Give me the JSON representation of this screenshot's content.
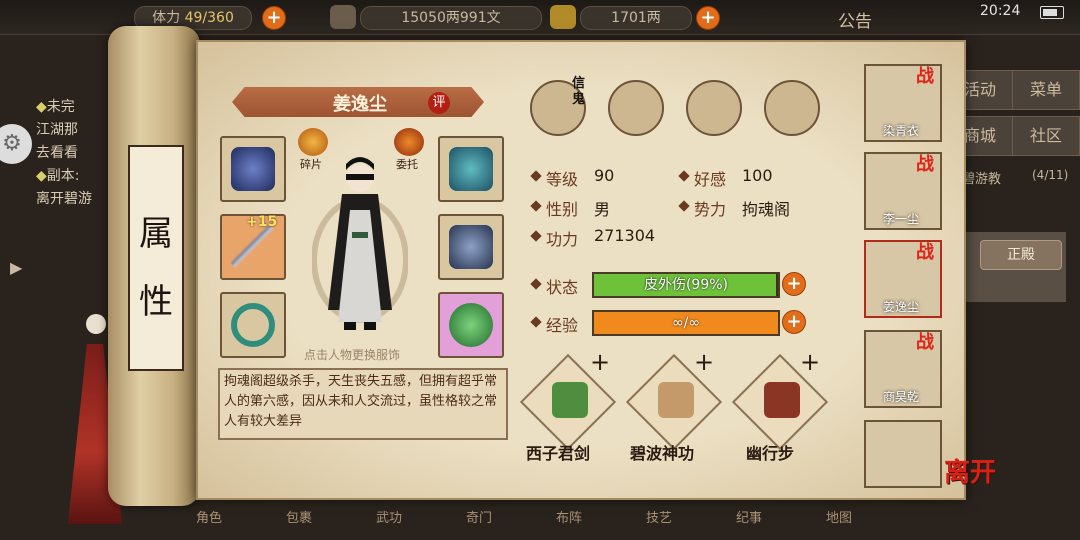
{
  "topbar": {
    "level_label": "体力",
    "stamina": "49/360",
    "silver": "15050两991文",
    "gold": "1701两",
    "notice": "公告",
    "time": "20:24"
  },
  "quest": {
    "line1": "未完",
    "line2": "江湖那",
    "line3": "去看看",
    "line4": "副本:",
    "line5": "离开碧游"
  },
  "bg_menu": {
    "activity": "活动",
    "menu": "菜单",
    "shop": "商城",
    "community": "社区",
    "biyou": "碧游教",
    "biyou_count": "(4/11)",
    "main": "正殿"
  },
  "scroll_title": "属性",
  "character": {
    "name": "姜逸尘",
    "rate": "评",
    "shard_label": "碎片",
    "delegate_label": "委托",
    "upgrade": "+15",
    "hint": "点击人物更换服饰",
    "bio": "拘魂阁超级杀手，天生丧失五感，但拥有超乎常人的第六感，因从未和人交流过，虽性格较之常人有较大差异"
  },
  "status_tag": "信鬼",
  "stats": {
    "level_label": "等级",
    "level_value": "90",
    "favor_label": "好感",
    "favor_value": "100",
    "gender_label": "性别",
    "gender_value": "男",
    "faction_label": "势力",
    "faction_value": "拘魂阁",
    "power_label": "功力",
    "power_value": "271304",
    "state_label": "状态",
    "state_text": "皮外伤(99%)",
    "state_progress": 0.99,
    "exp_label": "经验",
    "exp_text": "∞/∞",
    "exp_progress": 1.0
  },
  "skills": [
    {
      "name": "西子君剑"
    },
    {
      "name": "碧波神功"
    },
    {
      "name": "幽行步"
    }
  ],
  "skill_plus": "+",
  "roster": [
    {
      "name": "染青衣",
      "battle": "战"
    },
    {
      "name": "李一尘",
      "battle": "战"
    },
    {
      "name": "姜逸尘",
      "battle": "战"
    },
    {
      "name": "商昊乾",
      "battle": "战"
    },
    {
      "name": "",
      "battle": ""
    }
  ],
  "leave_label": "离开",
  "bottom_items": [
    "角色",
    "包裹",
    "武功",
    "奇门",
    "布阵",
    "技艺",
    "纪事",
    "地图"
  ],
  "colors": {
    "state_bar": "#6ec23a",
    "exp_bar": "#f08a1c",
    "plus_orange": "#e16d1a",
    "battle_red": "#e02518"
  }
}
